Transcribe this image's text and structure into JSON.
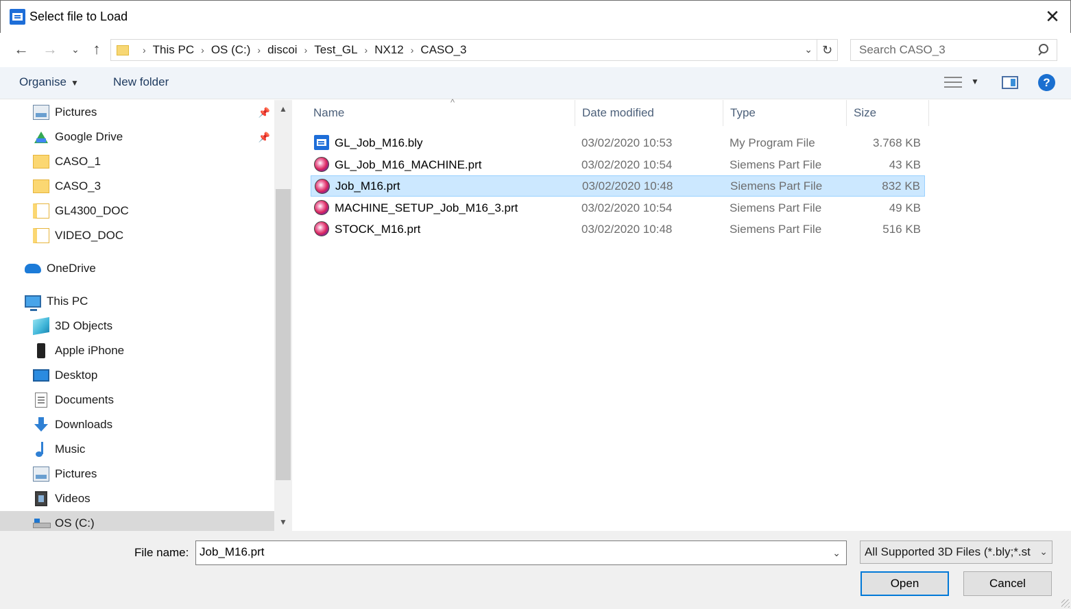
{
  "window": {
    "title": "Select file to Load",
    "close_glyph": "✕"
  },
  "nav": {
    "back_glyph": "←",
    "forward_glyph": "→",
    "recent_glyph": "⌄",
    "up_glyph": "↑",
    "refresh_glyph": "↻"
  },
  "address": {
    "crumbs": [
      "This PC",
      "OS (C:)",
      "discoi",
      "Test_GL",
      "NX12",
      "CASO_3"
    ],
    "separator": "›",
    "dropdown_glyph": "⌄"
  },
  "search": {
    "placeholder": "Search CASO_3"
  },
  "toolbar": {
    "organise_label": "Organise",
    "organise_caret": "▼",
    "new_folder_label": "New folder",
    "view_caret": "▼",
    "help_label": "?"
  },
  "navpane": {
    "items": [
      {
        "label": "Pictures",
        "icon": "pictures-icon",
        "pinned": true
      },
      {
        "label": "Google Drive",
        "icon": "google-drive-icon",
        "pinned": true
      },
      {
        "label": "CASO_1",
        "icon": "folder-icon"
      },
      {
        "label": "CASO_3",
        "icon": "folder-icon"
      },
      {
        "label": "GL4300_DOC",
        "icon": "document-folder-icon"
      },
      {
        "label": "VIDEO_DOC",
        "icon": "document-folder-icon"
      },
      {
        "label": "OneDrive",
        "icon": "onedrive-icon"
      },
      {
        "label": "This PC",
        "icon": "this-pc-icon"
      },
      {
        "label": "3D Objects",
        "icon": "3d-objects-icon"
      },
      {
        "label": "Apple iPhone",
        "icon": "iphone-icon"
      },
      {
        "label": "Desktop",
        "icon": "desktop-icon"
      },
      {
        "label": "Documents",
        "icon": "documents-icon"
      },
      {
        "label": "Downloads",
        "icon": "downloads-icon"
      },
      {
        "label": "Music",
        "icon": "music-icon"
      },
      {
        "label": "Pictures",
        "icon": "pictures-icon"
      },
      {
        "label": "Videos",
        "icon": "videos-icon"
      },
      {
        "label": "OS (C:)",
        "icon": "drive-icon",
        "selected": true
      }
    ],
    "pin_glyph": "📌",
    "scroll_up_glyph": "▲",
    "scroll_down_glyph": "▼"
  },
  "filelist": {
    "columns": [
      "Name",
      "Date modified",
      "Type",
      "Size"
    ],
    "sort_glyph": "^",
    "files": [
      {
        "name": "GL_Job_M16.bly",
        "date": "03/02/2020 10:53",
        "type": "My Program File",
        "size": "3.768 KB",
        "icon": "bly-file-icon"
      },
      {
        "name": "GL_Job_M16_MACHINE.prt",
        "date": "03/02/2020 10:54",
        "type": "Siemens Part File",
        "size": "43 KB",
        "icon": "siemens-part-icon"
      },
      {
        "name": "Job_M16.prt",
        "date": "03/02/2020 10:48",
        "type": "Siemens Part File",
        "size": "832 KB",
        "icon": "siemens-part-icon",
        "selected": true
      },
      {
        "name": "MACHINE_SETUP_Job_M16_3.prt",
        "date": "03/02/2020 10:54",
        "type": "Siemens Part File",
        "size": "49 KB",
        "icon": "siemens-part-icon"
      },
      {
        "name": "STOCK_M16.prt",
        "date": "03/02/2020 10:48",
        "type": "Siemens Part File",
        "size": "516 KB",
        "icon": "siemens-part-icon"
      }
    ]
  },
  "footer": {
    "file_name_label": "File name:",
    "file_name_value": "Job_M16.prt",
    "file_name_caret": "⌄",
    "file_type_value": "All Supported 3D Files (*.bly;*.st",
    "file_type_caret": "⌄",
    "open_label": "Open",
    "cancel_label": "Cancel"
  },
  "colors": {
    "selection": "#cce8ff",
    "selection_border": "#99d1ff",
    "accent": "#0078d7",
    "toolbar_bg": "#f0f4f9"
  }
}
